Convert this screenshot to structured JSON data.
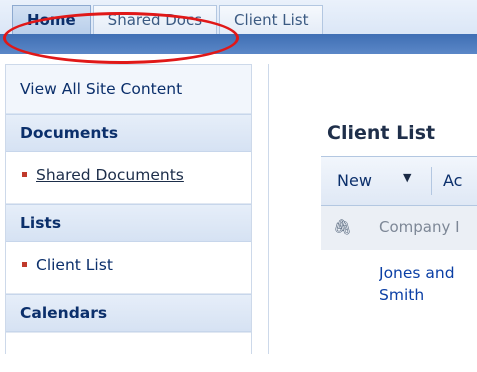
{
  "tabs": [
    "Home",
    "Shared Docs",
    "Client List"
  ],
  "left_nav": {
    "view_all": "View All Site Content",
    "sections": [
      {
        "heading": "Documents",
        "items": [
          "Shared Documents"
        ]
      },
      {
        "heading": "Lists",
        "items": [
          "Client List"
        ]
      },
      {
        "heading": "Calendars",
        "items": []
      }
    ]
  },
  "content": {
    "title": "Client List",
    "toolbar": {
      "new_label": "New",
      "caret": "▼",
      "actions_label": "Ac"
    },
    "column_header": {
      "attachment_icon": "paperclip-icon",
      "company_label": "Company I"
    },
    "row_text": [
      "Jones and",
      "Smith"
    ]
  },
  "colors": {
    "accent": "#003399",
    "highlight": "#e01818",
    "bullet": "#c0392b"
  }
}
